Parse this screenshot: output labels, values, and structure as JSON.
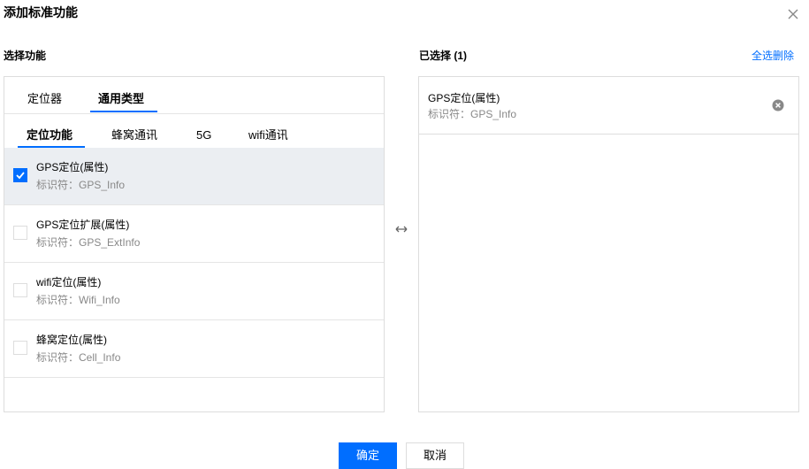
{
  "dialog": {
    "title": "添加标准功能",
    "close_icon": "close-icon"
  },
  "left": {
    "label": "选择功能",
    "tabs": [
      {
        "label": "定位器",
        "active": false
      },
      {
        "label": "通用类型",
        "active": true
      }
    ],
    "subtabs": [
      {
        "label": "定位功能",
        "active": true
      },
      {
        "label": "蜂窝通讯",
        "active": false
      },
      {
        "label": "5G",
        "active": false
      },
      {
        "label": "wifi通讯",
        "active": false
      }
    ],
    "items": [
      {
        "name": "GPS定位(属性)",
        "id_text": "标识符：GPS_Info",
        "checked": true
      },
      {
        "name": "GPS定位扩展(属性)",
        "id_text": "标识符：GPS_ExtInfo",
        "checked": false
      },
      {
        "name": "wifi定位(属性)",
        "id_text": "标识符：Wifi_Info",
        "checked": false
      },
      {
        "name": "蜂窝定位(属性)",
        "id_text": "标识符：Cell_Info",
        "checked": false
      }
    ]
  },
  "transfer_icon": "left-right-arrow-icon",
  "right": {
    "label": "已选择 (1)",
    "clear_all": "全选删除",
    "selected": [
      {
        "name": "GPS定位(属性)",
        "id_text": "标识符：GPS_Info"
      }
    ]
  },
  "buttons": {
    "confirm": "确定",
    "cancel": "取消"
  },
  "colors": {
    "accent": "#006eff",
    "selected_row": "#ebeef2",
    "border": "#dddddd",
    "muted_text": "#888888"
  }
}
